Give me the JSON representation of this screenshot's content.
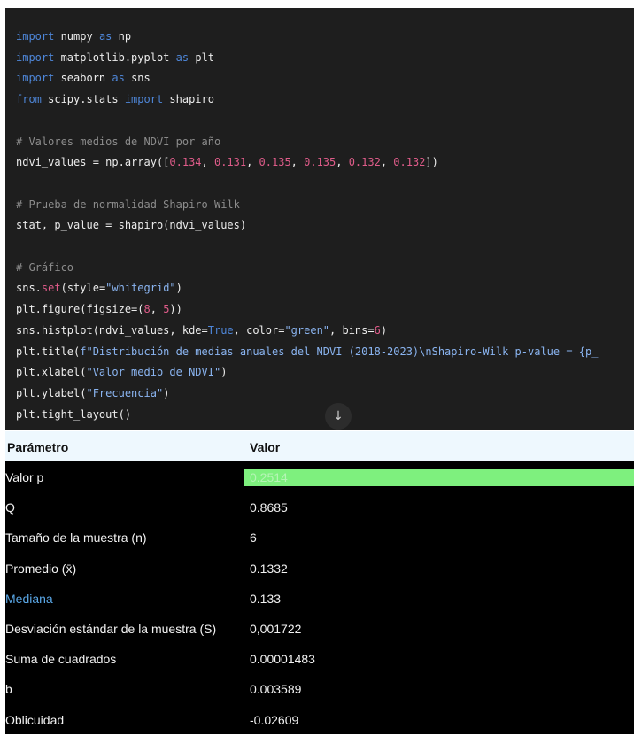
{
  "code_lines": [
    [
      {
        "t": "import",
        "c": "kw"
      },
      {
        "t": " numpy "
      },
      {
        "t": "as",
        "c": "kw"
      },
      {
        "t": " np"
      }
    ],
    [
      {
        "t": "import",
        "c": "kw"
      },
      {
        "t": " matplotlib.pyplot "
      },
      {
        "t": "as",
        "c": "kw"
      },
      {
        "t": " plt"
      }
    ],
    [
      {
        "t": "import",
        "c": "kw"
      },
      {
        "t": " seaborn "
      },
      {
        "t": "as",
        "c": "kw"
      },
      {
        "t": " sns"
      }
    ],
    [
      {
        "t": "from",
        "c": "kw"
      },
      {
        "t": " scipy.stats "
      },
      {
        "t": "import",
        "c": "kw"
      },
      {
        "t": " shapiro"
      }
    ],
    [],
    [
      {
        "t": "# Valores medios de NDVI por año",
        "c": "cmt"
      }
    ],
    [
      {
        "t": "ndvi_values = np.array(["
      },
      {
        "t": "0.134",
        "c": "num"
      },
      {
        "t": ", "
      },
      {
        "t": "0.131",
        "c": "num"
      },
      {
        "t": ", "
      },
      {
        "t": "0.135",
        "c": "num"
      },
      {
        "t": ", "
      },
      {
        "t": "0.135",
        "c": "num"
      },
      {
        "t": ", "
      },
      {
        "t": "0.132",
        "c": "num"
      },
      {
        "t": ", "
      },
      {
        "t": "0.132",
        "c": "num"
      },
      {
        "t": "])"
      }
    ],
    [],
    [
      {
        "t": "# Prueba de normalidad Shapiro-Wilk",
        "c": "cmt"
      }
    ],
    [
      {
        "t": "stat, p_value = shapiro(ndvi_values)"
      }
    ],
    [],
    [
      {
        "t": "# Gráfico",
        "c": "cmt"
      }
    ],
    [
      {
        "t": "sns."
      },
      {
        "t": "set",
        "c": "fn"
      },
      {
        "t": "(style="
      },
      {
        "t": "\"whitegrid\"",
        "c": "str"
      },
      {
        "t": ")"
      }
    ],
    [
      {
        "t": "plt.figure(figsize=("
      },
      {
        "t": "8",
        "c": "num"
      },
      {
        "t": ", "
      },
      {
        "t": "5",
        "c": "num"
      },
      {
        "t": "))"
      }
    ],
    [
      {
        "t": "sns.histplot(ndvi_values, kde="
      },
      {
        "t": "True",
        "c": "kw"
      },
      {
        "t": ", color="
      },
      {
        "t": "\"green\"",
        "c": "str"
      },
      {
        "t": ", bins="
      },
      {
        "t": "6",
        "c": "num"
      },
      {
        "t": ")"
      }
    ],
    [
      {
        "t": "plt.title("
      },
      {
        "t": "f\"Distribución de medias anuales del NDVI (2018-2023)\\nShapiro-Wilk p-value = {p_",
        "c": "str"
      }
    ],
    [
      {
        "t": "plt.xlabel("
      },
      {
        "t": "\"Valor medio de NDVI\"",
        "c": "str"
      },
      {
        "t": ")"
      }
    ],
    [
      {
        "t": "plt.ylabel("
      },
      {
        "t": "\"Frecuencia\"",
        "c": "str"
      },
      {
        "t": ")"
      }
    ],
    [
      {
        "t": "plt.tight_layout()"
      }
    ]
  ],
  "scroll_icon": "arrow-down-icon",
  "scroll_glyph": "↓",
  "table": {
    "headers": [
      "Parámetro",
      "Valor"
    ],
    "rows": [
      [
        "Valor p",
        "0.2514"
      ],
      [
        "Q",
        "0.8685"
      ],
      [
        "Tamaño de la muestra (n)",
        "6"
      ],
      [
        "Promedio (x̄)",
        "0.1332"
      ],
      [
        "Mediana",
        "0.133"
      ],
      [
        "Desviación estándar de la muestra (S)",
        "0,001722"
      ],
      [
        "Suma de cuadrados",
        "0.00001483"
      ],
      [
        "b",
        "0.003589"
      ],
      [
        "Oblicuidad",
        "-0.02609"
      ]
    ],
    "highlight_color": "#7ef07e",
    "link_color": "#5aa7e6"
  }
}
